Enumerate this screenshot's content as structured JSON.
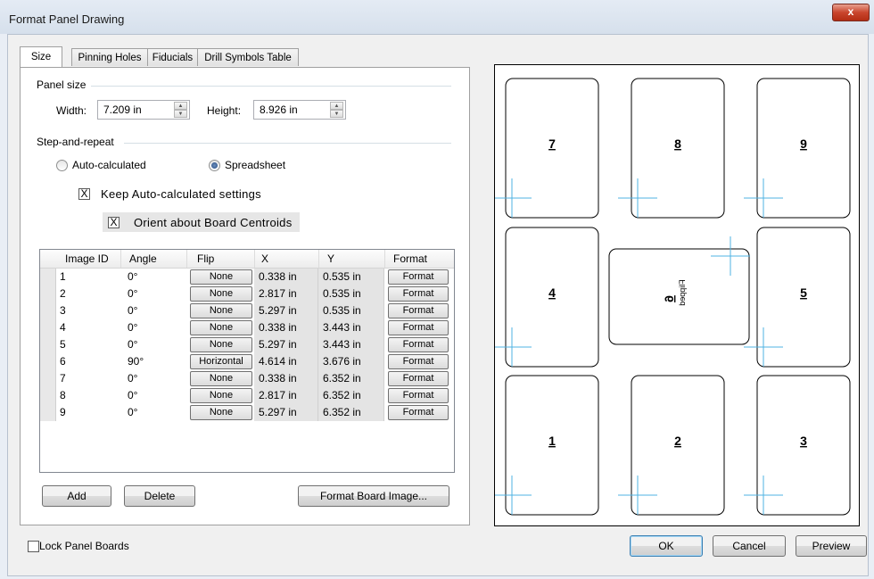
{
  "window": {
    "title": "Format Panel Drawing",
    "close_glyph": "x"
  },
  "tabs": [
    {
      "label": "Size",
      "active": true
    },
    {
      "label": "Pinning Holes",
      "active": false
    },
    {
      "label": "Fiducials",
      "active": false
    },
    {
      "label": "Drill Symbols Table",
      "active": false
    }
  ],
  "panel_size": {
    "group_label": "Panel size",
    "width_label": "Width:",
    "width_value": "7.209 in",
    "height_label": "Height:",
    "height_value": "8.926 in"
  },
  "step_repeat": {
    "group_label": "Step-and-repeat",
    "auto_label": "Auto-calculated",
    "spreadsheet_label": "Spreadsheet",
    "selected": "Spreadsheet",
    "keep_label": "Keep Auto-calculated settings",
    "keep_checked": true,
    "orient_label": "Orient about Board Centroids",
    "orient_checked": true,
    "check_glyph": "X"
  },
  "table": {
    "columns": [
      "Image ID",
      "Angle",
      "Flip",
      "X",
      "Y",
      "Format"
    ],
    "rows": [
      {
        "id": "1",
        "angle": "0°",
        "flip": "None",
        "x": "0.338 in",
        "y": "0.535 in",
        "format": "Format"
      },
      {
        "id": "2",
        "angle": "0°",
        "flip": "None",
        "x": "2.817 in",
        "y": "0.535 in",
        "format": "Format"
      },
      {
        "id": "3",
        "angle": "0°",
        "flip": "None",
        "x": "5.297 in",
        "y": "0.535 in",
        "format": "Format"
      },
      {
        "id": "4",
        "angle": "0°",
        "flip": "None",
        "x": "0.338 in",
        "y": "3.443 in",
        "format": "Format"
      },
      {
        "id": "5",
        "angle": "0°",
        "flip": "None",
        "x": "5.297 in",
        "y": "3.443 in",
        "format": "Format"
      },
      {
        "id": "6",
        "angle": "90°",
        "flip": "Horizontal",
        "x": "4.614 in",
        "y": "3.676 in",
        "format": "Format"
      },
      {
        "id": "7",
        "angle": "0°",
        "flip": "None",
        "x": "0.338 in",
        "y": "6.352 in",
        "format": "Format"
      },
      {
        "id": "8",
        "angle": "0°",
        "flip": "None",
        "x": "2.817 in",
        "y": "6.352 in",
        "format": "Format"
      },
      {
        "id": "9",
        "angle": "0°",
        "flip": "None",
        "x": "5.297 in",
        "y": "6.352 in",
        "format": "Format"
      }
    ]
  },
  "buttons": {
    "add": "Add",
    "delete": "Delete",
    "format_board": "Format Board Image...",
    "ok": "OK",
    "cancel": "Cancel",
    "preview": "Preview"
  },
  "lock_panel": {
    "label": "Lock Panel Boards",
    "checked": false
  },
  "preview": {
    "boards": [
      "7",
      "8",
      "9",
      "4",
      "6",
      "5",
      "1",
      "2",
      "3"
    ],
    "flipped_text": "Flipped"
  },
  "colors": {
    "crosshair": "#4fb3e3",
    "close_button": "#c9452d"
  }
}
